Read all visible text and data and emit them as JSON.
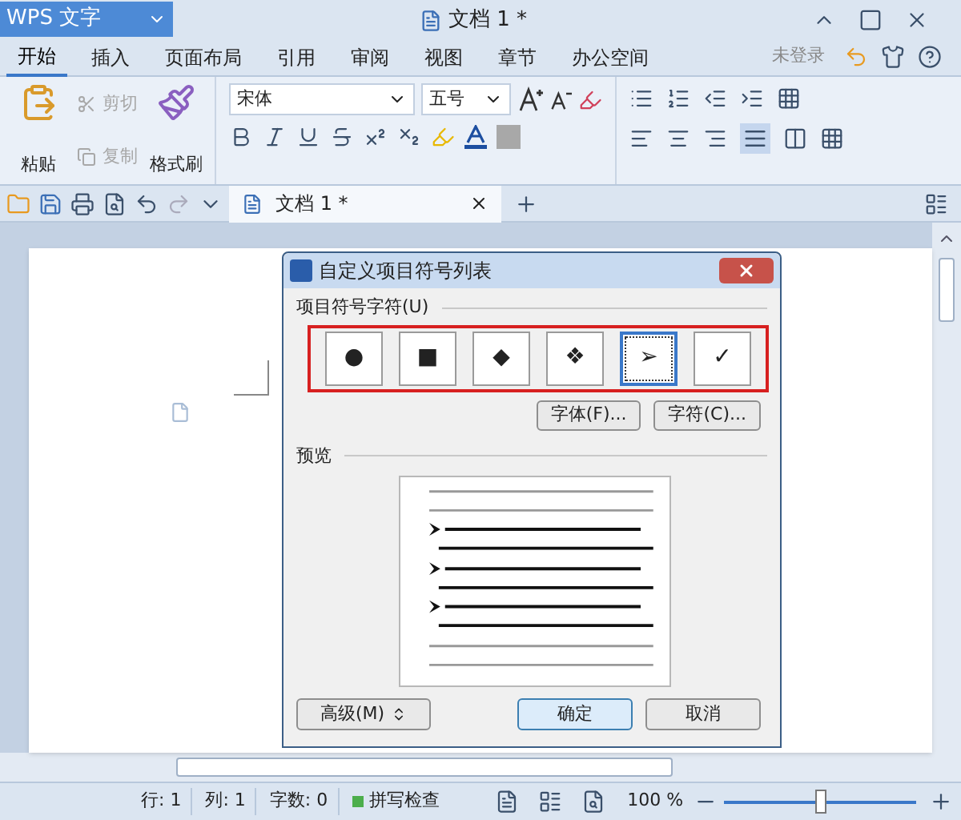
{
  "app_button": {
    "label": "WPS 文字"
  },
  "window": {
    "title": "文档 1 *"
  },
  "menu_tabs": [
    {
      "label": "开始",
      "selected": true
    },
    {
      "label": "插入",
      "selected": false
    },
    {
      "label": "页面布局",
      "selected": false
    },
    {
      "label": "引用",
      "selected": false
    },
    {
      "label": "审阅",
      "selected": false
    },
    {
      "label": "视图",
      "selected": false
    },
    {
      "label": "章节",
      "selected": false
    },
    {
      "label": "办公空间",
      "selected": false
    }
  ],
  "account": {
    "label": "未登录"
  },
  "ribbon": {
    "paste": "粘贴",
    "cut": {
      "label": "剪切",
      "disabled": true
    },
    "copy": {
      "label": "复制",
      "disabled": true
    },
    "format_painter": "格式刷",
    "font": {
      "value": "宋体"
    },
    "font_size": {
      "value": "五号"
    },
    "justify_selected": true
  },
  "document_tabs": [
    {
      "label": "文档 1 *",
      "selected": true
    }
  ],
  "dialog": {
    "title": "自定义项目符号列表",
    "symbols_label": "项目符号字符(U)",
    "symbols": [
      {
        "char": "●",
        "selected": false
      },
      {
        "char": "■",
        "selected": false
      },
      {
        "char": "◆",
        "selected": false
      },
      {
        "char": "❖",
        "selected": false
      },
      {
        "char": "➢",
        "selected": true
      },
      {
        "char": "✓",
        "selected": false
      }
    ],
    "font_button": "字体(F)...",
    "char_button": "字符(C)...",
    "preview_label": "预览",
    "advanced_button": "高级(M)",
    "ok_button": "确定",
    "cancel_button": "取消"
  },
  "status_bar": {
    "items": [
      "行: 1",
      "列: 1",
      "字数: 0"
    ],
    "spell_check": "拼写检查",
    "zoom": "100 %",
    "zoom_slider": {
      "level": 0.5
    }
  }
}
